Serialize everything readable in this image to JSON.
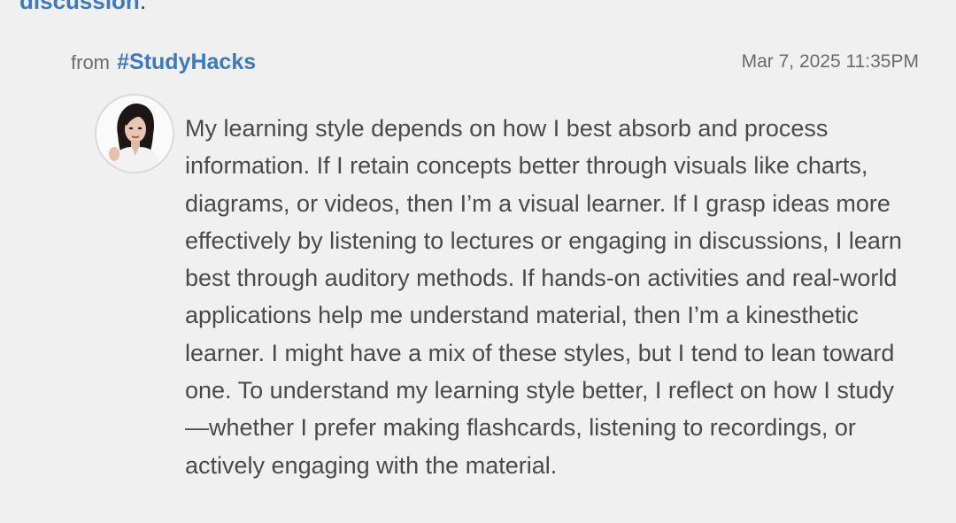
{
  "top_link": {
    "text": "discussion",
    "suffix": "."
  },
  "post": {
    "from_label": "from",
    "channel": "#StudyHacks",
    "timestamp": "Mar 7, 2025 11:35PM",
    "body_lines": [
      "My learning style depends on how I best absorb and process",
      "information. If I retain concepts better through visuals like charts,",
      "diagrams, or videos, then I’m a visual learner. If I grasp ideas more",
      "effectively by listening to lectures or engaging in discussions, I learn",
      "best through auditory methods. If hands-on activities and real-world",
      "applications help me understand material, then I’m a kinesthetic",
      "learner. I might have a mix of these styles, but I tend to lean toward",
      "one. To understand my learning style better, I reflect on how I study",
      "—whether I prefer making flashcards, listening to recordings, or",
      "actively engaging with the material."
    ]
  },
  "colors": {
    "background": "#f0f0f0",
    "link": "#3c7ac0",
    "body_text": "#4a4a4a",
    "meta_text": "#6b6b6b"
  }
}
